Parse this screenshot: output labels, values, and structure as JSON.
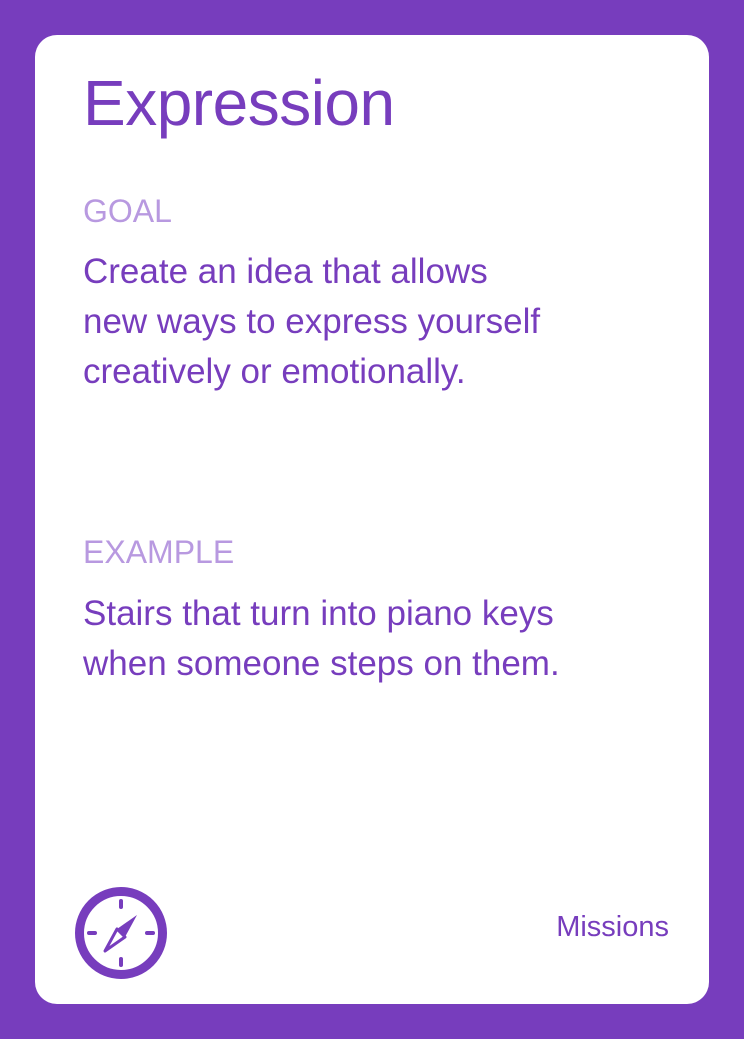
{
  "card": {
    "title": "Expression",
    "goal": {
      "label": "GOAL",
      "text": "Create an idea that allows\nnew ways to express yourself\ncreatively or emotionally."
    },
    "example": {
      "label": "EXAMPLE",
      "text": "Stairs that turn into piano keys\nwhen someone steps on them."
    },
    "category": "Missions",
    "icon": "compass-icon"
  },
  "colors": {
    "background": "#773dbd",
    "card": "#ffffff",
    "title": "#773dbd",
    "label": "#b899e0",
    "text": "#773dbd"
  }
}
